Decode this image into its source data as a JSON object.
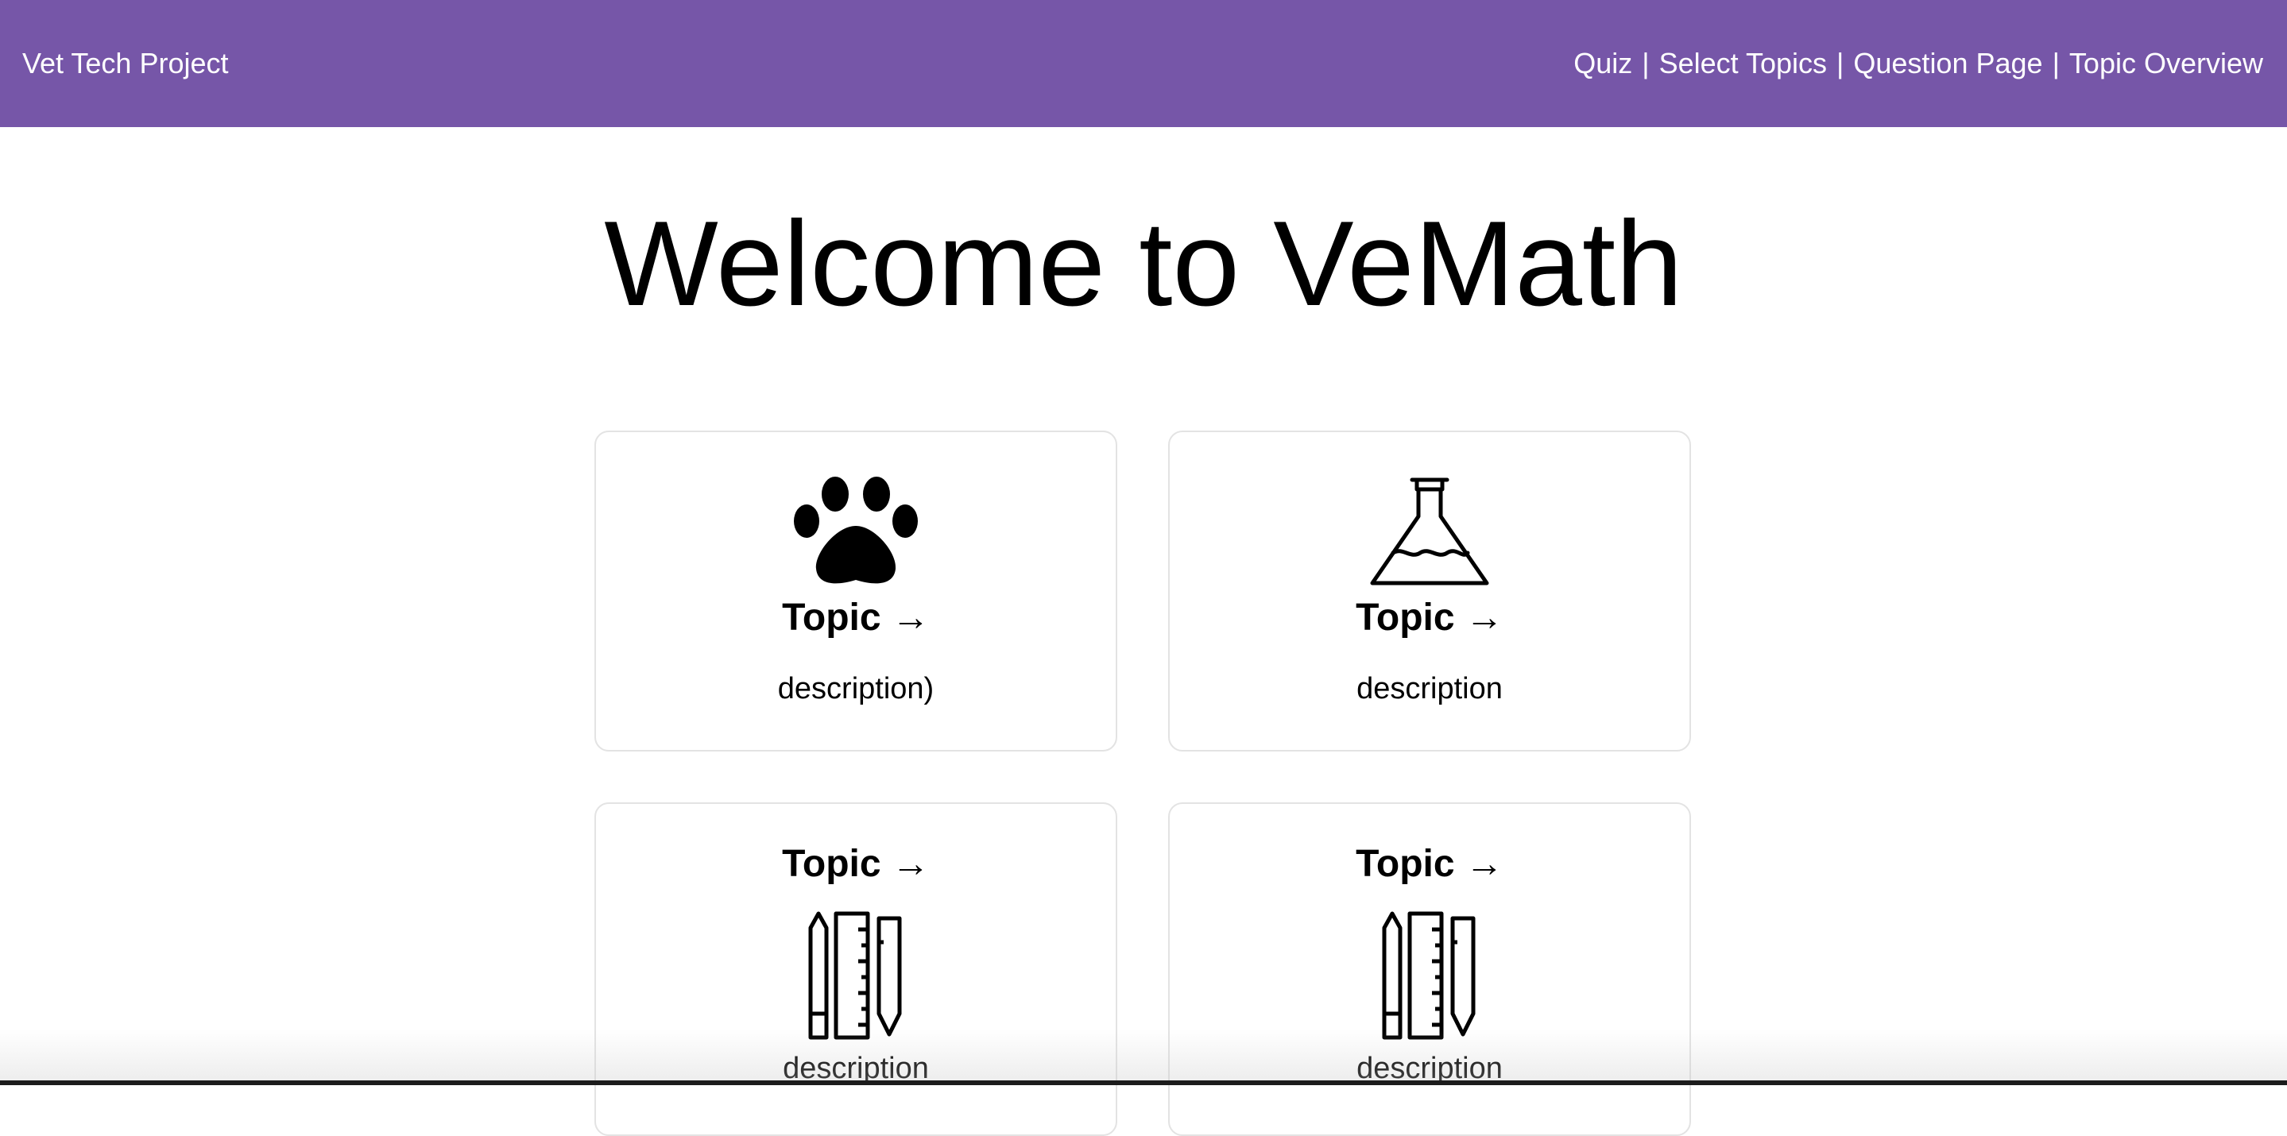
{
  "navbar": {
    "brand": "Vet Tech Project",
    "links": [
      "Quiz",
      "Select Topics",
      "Question Page",
      "Topic Overview"
    ],
    "separator": "|",
    "background_color": "#7656a8"
  },
  "main": {
    "title": "Welcome to VeMath"
  },
  "cards": [
    {
      "icon": "paw-icon",
      "title": "Topic →",
      "description": "description)"
    },
    {
      "icon": "flask-icon",
      "title": "Topic →",
      "description": "description"
    },
    {
      "icon": "drafting-tools-icon",
      "title": "Topic →",
      "description": "description"
    },
    {
      "icon": "drafting-tools-icon",
      "title": "Topic →",
      "description": "description"
    }
  ]
}
